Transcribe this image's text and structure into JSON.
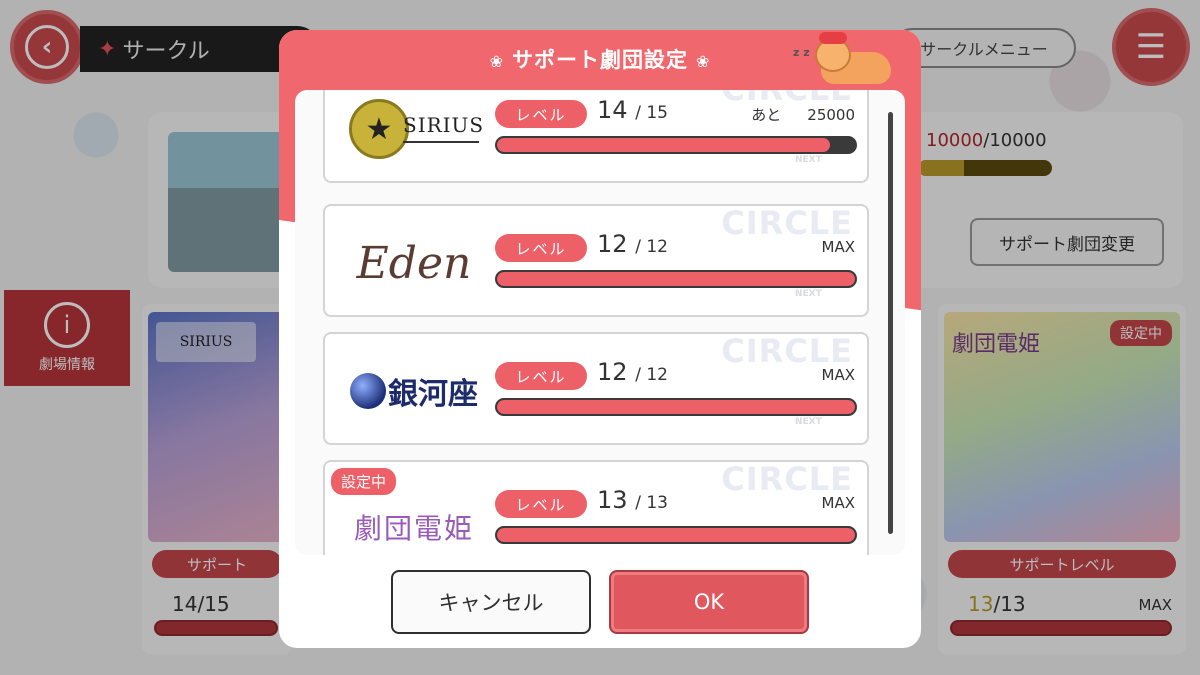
{
  "background": {
    "screen_title": "サークル",
    "circle_menu_label": "サークルメニュー",
    "exp_current": "10000",
    "exp_separator_max": "/10000",
    "exp_fill": 0.34,
    "support_change_label": "サポート劇団変更",
    "theater_info_label": "劇場情報",
    "left_card": {
      "logo": "SIRIUS",
      "label": "サポート",
      "level": "14/15"
    },
    "right_card": {
      "logo": "劇団電姫",
      "badge": "設定中",
      "label": "サポートレベル",
      "level_current": "13",
      "level_max": "/13",
      "status": "MAX"
    }
  },
  "dialog": {
    "title": "サポート劇団設定",
    "watermark": "CIRCLE",
    "next_mark": "NEXT",
    "level_label": "レベル",
    "troupes": [
      {
        "logo": "SIRIUS",
        "level": "14",
        "max": "/ 15",
        "status_prefix": "あと",
        "status_value": "25000",
        "fill": 0.93,
        "badge": ""
      },
      {
        "logo": "Eden",
        "level": "12",
        "max": "/ 12",
        "status_prefix": "",
        "status_value": "MAX",
        "fill": 1.0,
        "badge": ""
      },
      {
        "logo": "銀河座",
        "level": "12",
        "max": "/ 12",
        "status_prefix": "",
        "status_value": "MAX",
        "fill": 1.0,
        "badge": ""
      },
      {
        "logo": "劇団電姫",
        "level": "13",
        "max": "/ 13",
        "status_prefix": "",
        "status_value": "MAX",
        "fill": 1.0,
        "badge": "設定中"
      }
    ],
    "cancel_label": "キャンセル",
    "ok_label": "OK"
  },
  "colors": {
    "accent": "#ed6068",
    "header": "#f0686e",
    "bar_bg": "#3a3a3a"
  }
}
